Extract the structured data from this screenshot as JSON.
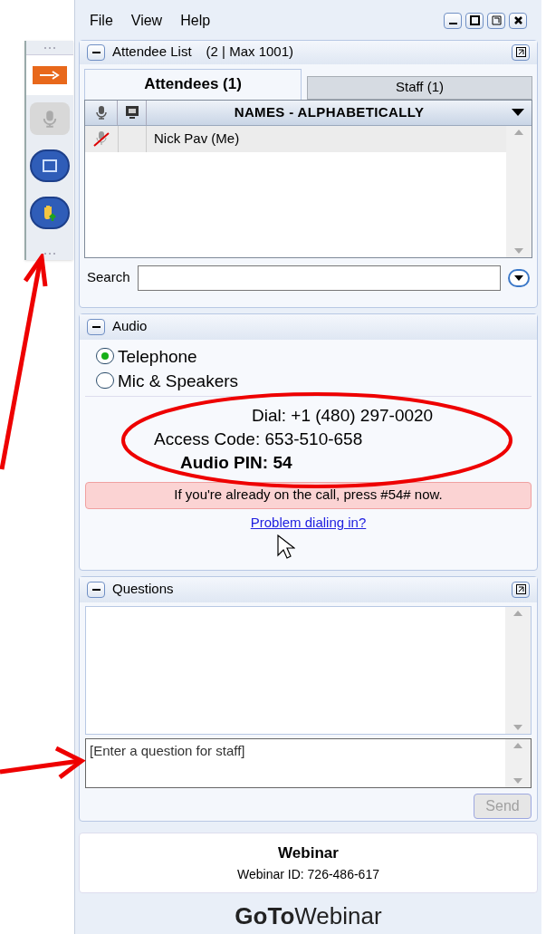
{
  "menu": [
    "File",
    "View",
    "Help"
  ],
  "attendee_panel": {
    "title": "Attendee List",
    "count": "(2 | Max 1001)",
    "tabs": [
      {
        "label": "Attendees (1)",
        "selected": true
      },
      {
        "label": "Staff (1)",
        "selected": false
      }
    ],
    "column_header": "NAMES - ALPHABETICALLY",
    "rows": [
      {
        "name": "Nick Pav (Me)",
        "muted": true
      }
    ],
    "search_label": "Search"
  },
  "audio": {
    "title": "Audio",
    "options": [
      {
        "label": "Telephone",
        "selected": true
      },
      {
        "label": "Mic & Speakers",
        "selected": false
      }
    ],
    "dial": "Dial: +1 (480) 297-0020",
    "access_code": "Access Code: 653-510-658",
    "pin": "Audio PIN: 54",
    "notice": "If you're already on the call, press #54# now.",
    "help_link": "Problem dialing in?"
  },
  "questions": {
    "title": "Questions",
    "placeholder": "[Enter a question for staff]",
    "send": {
      "label": "Send",
      "disabled": true
    }
  },
  "webinar": {
    "title": "Webinar",
    "id": "Webinar ID: 726-486-617"
  },
  "logo": "**GoTo**Webinar"
}
